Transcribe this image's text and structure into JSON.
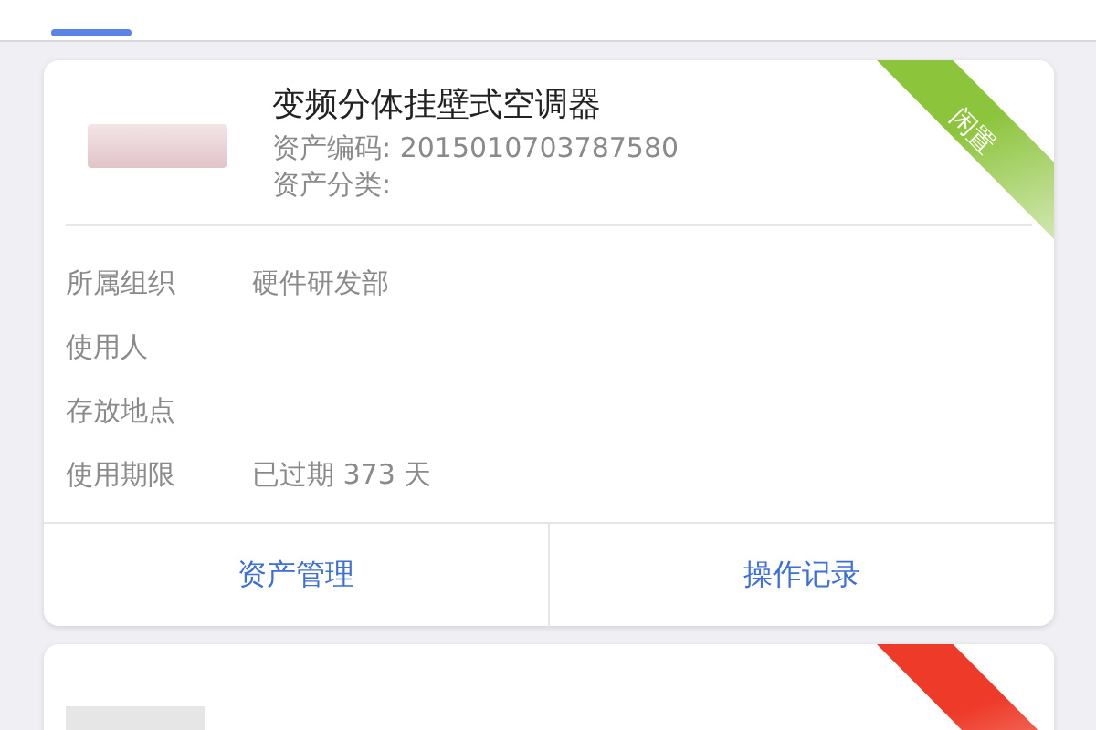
{
  "tabs": [
    {
      "selected": true
    },
    {
      "selected": false
    },
    {
      "selected": false
    },
    {
      "selected": false
    },
    {
      "selected": false
    },
    {
      "selected": false
    }
  ],
  "cards": [
    {
      "title": "变频分体挂壁式空调器",
      "status": "闲置",
      "color": "#8cc43c",
      "code_label": "资产编码:",
      "code": "2015010703787580",
      "category_label": "资产分类:",
      "fields": [
        {
          "label": "所属组织",
          "value": "硬件研发部"
        },
        {
          "label": "使用人"
        },
        {
          "label": "存放地点"
        },
        {
          "label": "使用期限",
          "value": "已过期 373 天"
        }
      ],
      "actions": [
        "资产管理",
        "操作记录"
      ]
    },
    {
      "color": "#ee3a28"
    }
  ]
}
